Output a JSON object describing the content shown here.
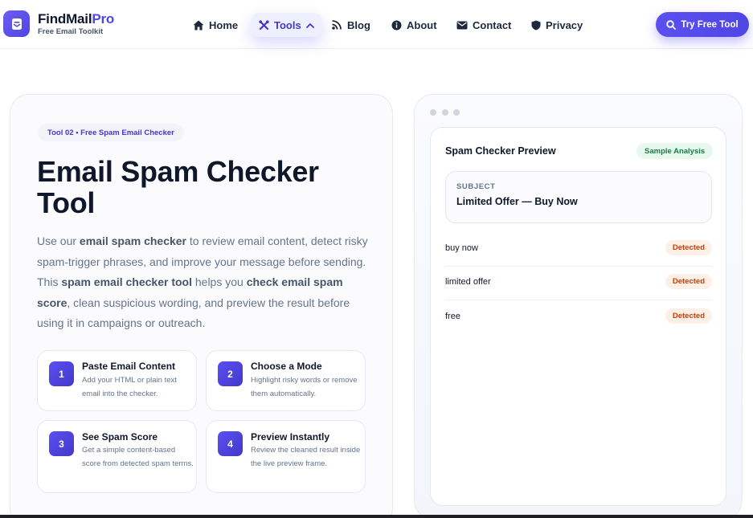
{
  "header": {
    "brand_name_main": "FindMail",
    "brand_name_accent": "Pro",
    "brand_subtitle": "Free Email Toolkit",
    "nav": [
      {
        "label": "Home",
        "icon": "home-icon"
      },
      {
        "label": "Tools",
        "icon": "tools-icon",
        "active": true
      },
      {
        "label": "Blog",
        "icon": "blog-icon"
      },
      {
        "label": "About",
        "icon": "info-icon"
      },
      {
        "label": "Contact",
        "icon": "mail-icon"
      },
      {
        "label": "Privacy",
        "icon": "shield-icon"
      }
    ],
    "cta_label": "Try Free Tool"
  },
  "hero": {
    "pill": "Tool 02 • Free Spam Email Checker",
    "title": "Email Spam Checker Tool",
    "desc": {
      "p1": "Use our ",
      "b1": "email spam checker",
      "p2": " to review email content, detect risky spam-trigger phrases, and improve your message before sending. This ",
      "b2": "spam email checker tool",
      "p3": " helps you ",
      "b3": "check email spam score",
      "p4": ", clean suspicious wording, and preview the result before using it in campaigns or outreach."
    },
    "steps": [
      {
        "num": "1",
        "title": "Paste Email Content",
        "text": "Add your HTML or plain text email into the checker."
      },
      {
        "num": "2",
        "title": "Choose a Mode",
        "text": "Highlight risky words or remove them automatically."
      },
      {
        "num": "3",
        "title": "See Spam Score",
        "text": "Get a simple content-based score from detected spam terms."
      },
      {
        "num": "4",
        "title": "Preview Instantly",
        "text": "Review the cleaned result inside the live preview frame."
      }
    ]
  },
  "preview": {
    "title": "Spam Checker Preview",
    "badge": "Sample Analysis",
    "subject_label": "SUBJECT",
    "subject_value": "Limited Offer — Buy Now",
    "terms": [
      {
        "term": "buy now",
        "status": "Detected"
      },
      {
        "term": "limited offer",
        "status": "Detected"
      },
      {
        "term": "free",
        "status": "Detected"
      }
    ]
  },
  "colors": {
    "accent": "#4f46e5",
    "success": "#15803d",
    "warning": "#c2410c"
  }
}
